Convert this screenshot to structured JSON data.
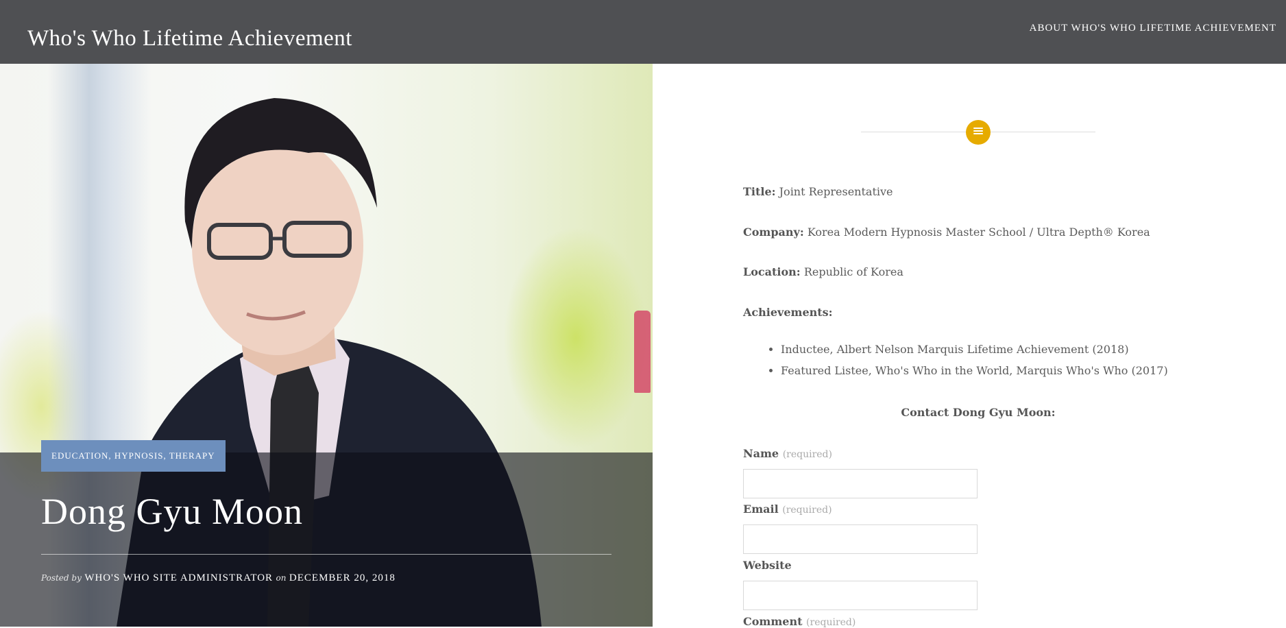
{
  "header": {
    "site_title": "Who's Who Lifetime Achievement",
    "nav_about": "About Who's Who Lifetime Achievement"
  },
  "hero": {
    "categories": "Education, Hypnosis, Therapy",
    "post_title": "Dong Gyu Moon",
    "posted_by_label": "Posted by",
    "author": "Who's Who Site Administrator",
    "on_label": "on",
    "date": "December 20, 2018"
  },
  "profile": {
    "title_label": "Title:",
    "title_value": "Joint Representative",
    "company_label": "Company:",
    "company_value": "Korea Modern Hypnosis Master School / Ultra Depth® Korea",
    "location_label": "Location:",
    "location_value": "Republic of Korea",
    "achievements_label": "Achievements:",
    "achievements": [
      "Inductee, Albert Nelson Marquis Lifetime Achievement (2018)",
      "Featured Listee, Who's Who in the World, Marquis Who's Who (2017)"
    ]
  },
  "contact": {
    "heading": "Contact Dong Gyu Moon:",
    "name_label": "Name",
    "email_label": "Email",
    "website_label": "Website",
    "comment_label": "Comment",
    "required": "(required)",
    "name_value": "",
    "email_value": "",
    "website_value": ""
  },
  "colors": {
    "header_bg": "#4f5053",
    "accent": "#e6ab00",
    "category_badge": "#6d8fbd"
  },
  "icons": {
    "format_badge": "post-format-icon"
  }
}
